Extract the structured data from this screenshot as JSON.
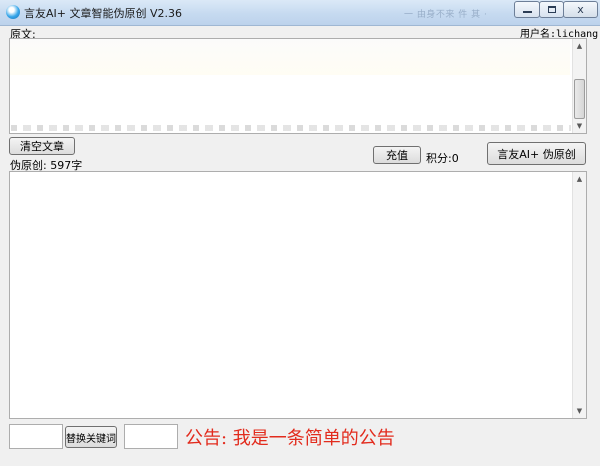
{
  "window": {
    "title": "言友AI+ 文章智能伪原创 V2.36",
    "watermark": "一 由身不来 件 其 ·",
    "close_glyph": "x"
  },
  "header": {
    "original_label": "原文:",
    "username_label": "用户名:lichang"
  },
  "toolbar": {
    "clear_label": "清空文章",
    "pseudo_count_label": "伪原创: 597字",
    "recharge_label": "充值",
    "points_label": "积分:0",
    "ai_button_label": "言友AI+ 伪原创"
  },
  "footer": {
    "replace_keyword_label": "替换关键词",
    "keyword_value_1": "",
    "keyword_value_2": "",
    "announcement": "公告: 我是一条简单的公告"
  },
  "icons": {
    "app": "app-icon",
    "scroll_up": "arrow-up-icon",
    "scroll_down": "arrow-down-icon"
  },
  "colors": {
    "announcement": "#e22b1d",
    "titlebar": "#c6daf0"
  }
}
